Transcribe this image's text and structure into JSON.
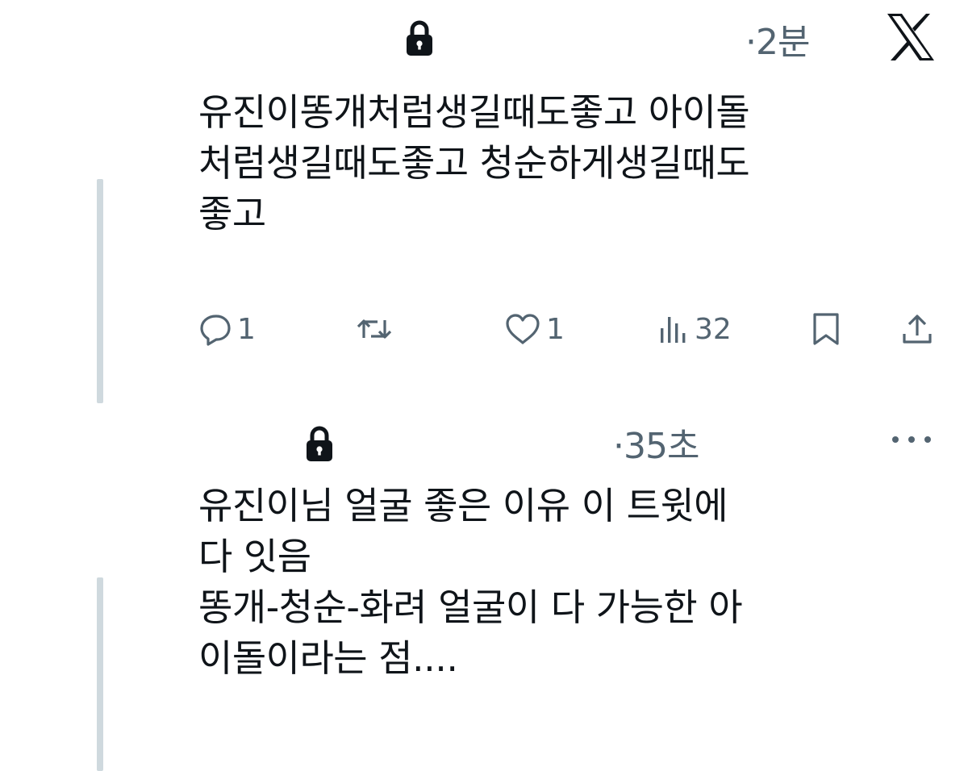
{
  "tweets": [
    {
      "time": "·2분",
      "text": "유진이똥개처럼생길때도좋고 아이돌\n처럼생길때도좋고 청순하게생길때도\n좋고",
      "actions": {
        "reply_count": "1",
        "retweet_count": "",
        "like_count": "1",
        "views_count": "32"
      }
    },
    {
      "time": "·35초",
      "text": "유진이님 얼굴 좋은 이유 이 트윗에\n다 잇음\n똥개-청순-화려 얼굴이 다 가능한 아\n이돌이라는 점...."
    }
  ],
  "icons": {
    "lock": "lock-icon",
    "brand": "x-logo-icon",
    "reply": "reply-icon",
    "retweet": "retweet-icon",
    "like": "heart-icon",
    "views": "views-icon",
    "bookmark": "bookmark-icon",
    "share": "share-icon",
    "more": "more-icon"
  },
  "colors": {
    "text": "#0f1419",
    "secondary": "#536471",
    "thread_line": "#cfd9de"
  }
}
